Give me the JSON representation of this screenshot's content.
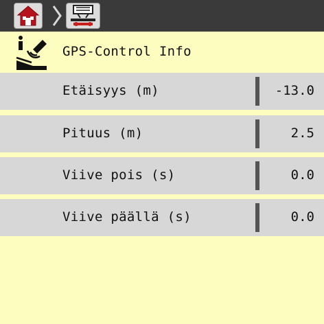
{
  "nav": {
    "home_icon": "home-icon",
    "spreader_icon": "spreader-settings-icon",
    "separator_icon": "chevron-right-icon"
  },
  "header": {
    "icon": "gps-info-icon",
    "title": "GPS-Control Info"
  },
  "rows": [
    {
      "label": "Etäisyys (m)",
      "value": "-13.0"
    },
    {
      "label": "Pituus (m)",
      "value": "2.5"
    },
    {
      "label": "Viive pois (s)",
      "value": "0.0"
    },
    {
      "label": "Viive päällä (s)",
      "value": "0.0"
    }
  ],
  "colors": {
    "background": "#fdfdc0",
    "topbar": "#3a3a3a",
    "row_background": "#d7d7d7",
    "home_icon_red": "#b5121b",
    "accent_red": "#c81e1e"
  }
}
